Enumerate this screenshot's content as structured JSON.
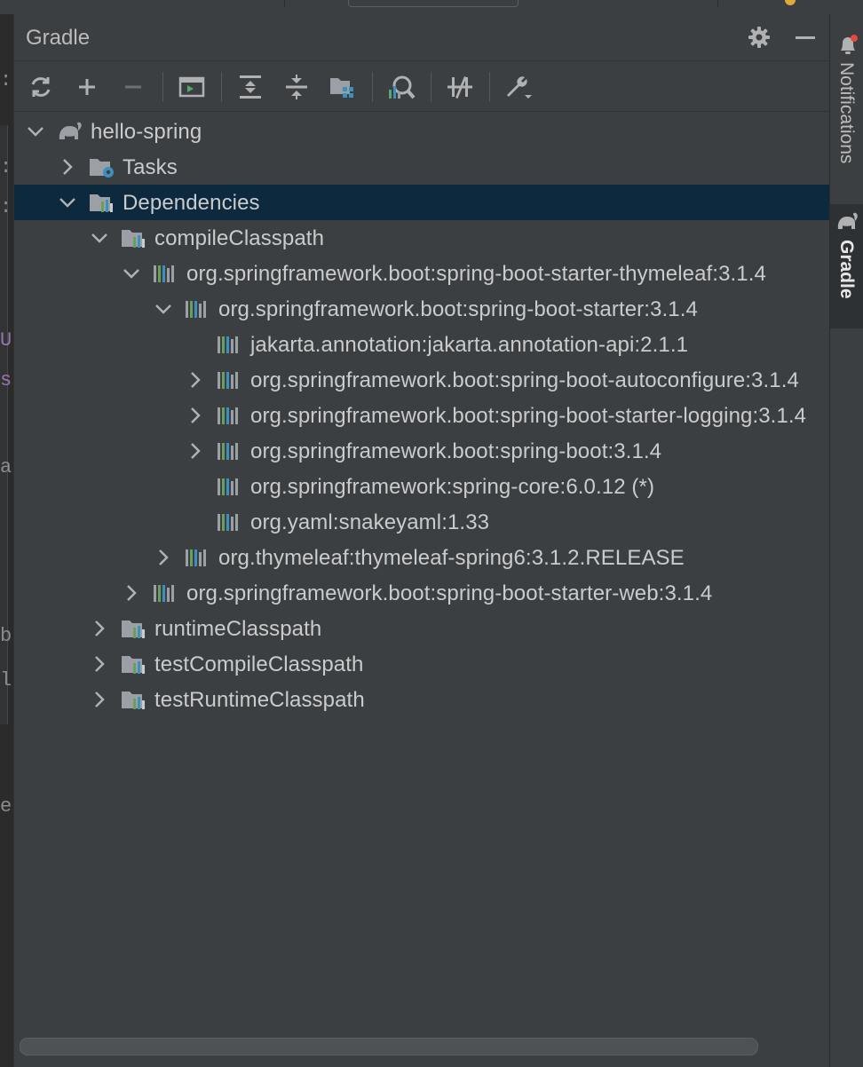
{
  "panel": {
    "title": "Gradle",
    "settings_icon": "gear-icon",
    "hide_icon": "minus-icon"
  },
  "toolbar": {
    "buttons": [
      {
        "name": "reload-all-gradle-projects",
        "icon": "sync-icon"
      },
      {
        "name": "link-gradle-project",
        "icon": "plus-icon"
      },
      {
        "name": "unlink-gradle-project",
        "icon": "minus-icon"
      },
      {
        "name": "execute-gradle-task",
        "icon": "terminal-icon"
      },
      {
        "name": "expand-all",
        "icon": "expand-all-icon"
      },
      {
        "name": "collapse-all",
        "icon": "collapse-all-icon"
      },
      {
        "name": "show-dependencies",
        "icon": "dependencies-icon"
      },
      {
        "name": "analyze-dependencies",
        "icon": "analyze-icon"
      },
      {
        "name": "toggle-offline-mode",
        "icon": "offline-icon"
      },
      {
        "name": "build-tool-settings",
        "icon": "wrench-icon"
      }
    ]
  },
  "tree": {
    "nodes": [
      {
        "label": "hello-spring",
        "icon": "gradle-elephant-icon",
        "expanded": true,
        "selected": false
      },
      {
        "label": "Tasks",
        "icon": "tasks-folder-icon",
        "expanded": false,
        "selected": false
      },
      {
        "label": "Dependencies",
        "icon": "dependencies-folder-icon",
        "expanded": true,
        "selected": true
      },
      {
        "label": "compileClasspath",
        "icon": "configuration-icon",
        "expanded": true,
        "selected": false
      },
      {
        "label": "org.springframework.boot:spring-boot-starter-thymeleaf:3.1.4",
        "icon": "library-icon",
        "expanded": true,
        "selected": false
      },
      {
        "label": "org.springframework.boot:spring-boot-starter:3.1.4",
        "icon": "library-icon",
        "expanded": true,
        "selected": false
      },
      {
        "label": "jakarta.annotation:jakarta.annotation-api:2.1.1",
        "icon": "library-icon",
        "expanded": null,
        "selected": false
      },
      {
        "label": "org.springframework.boot:spring-boot-autoconfigure:3.1.4",
        "icon": "library-icon",
        "expanded": false,
        "selected": false
      },
      {
        "label": "org.springframework.boot:spring-boot-starter-logging:3.1.4",
        "icon": "library-icon",
        "expanded": false,
        "selected": false
      },
      {
        "label": "org.springframework.boot:spring-boot:3.1.4",
        "icon": "library-icon",
        "expanded": false,
        "selected": false
      },
      {
        "label": "org.springframework:spring-core:6.0.12 (*)",
        "icon": "library-icon",
        "expanded": null,
        "selected": false
      },
      {
        "label": "org.yaml:snakeyaml:1.33",
        "icon": "library-icon",
        "expanded": null,
        "selected": false
      },
      {
        "label": "org.thymeleaf:thymeleaf-spring6:3.1.2.RELEASE",
        "icon": "library-icon",
        "expanded": false,
        "selected": false
      },
      {
        "label": "org.springframework.boot:spring-boot-starter-web:3.1.4",
        "icon": "library-icon",
        "expanded": false,
        "selected": false
      },
      {
        "label": "runtimeClasspath",
        "icon": "configuration-icon",
        "expanded": false,
        "selected": false
      },
      {
        "label": "testCompileClasspath",
        "icon": "configuration-icon",
        "expanded": false,
        "selected": false
      },
      {
        "label": "testRuntimeClasspath",
        "icon": "configuration-icon",
        "expanded": false,
        "selected": false
      }
    ]
  },
  "right_toolbar": {
    "tabs": [
      {
        "label": "Notifications",
        "icon": "bell-icon",
        "has_badge": true,
        "active": false
      },
      {
        "label": "Gradle",
        "icon": "gradle-elephant-icon",
        "active": true
      }
    ]
  },
  "colors": {
    "background": "#3c3f41",
    "selection": "#0d293e",
    "text": "#c9cbcd",
    "library_bars": [
      "#6a9f5a",
      "#3d8fbd",
      "#9aa0a6"
    ]
  }
}
